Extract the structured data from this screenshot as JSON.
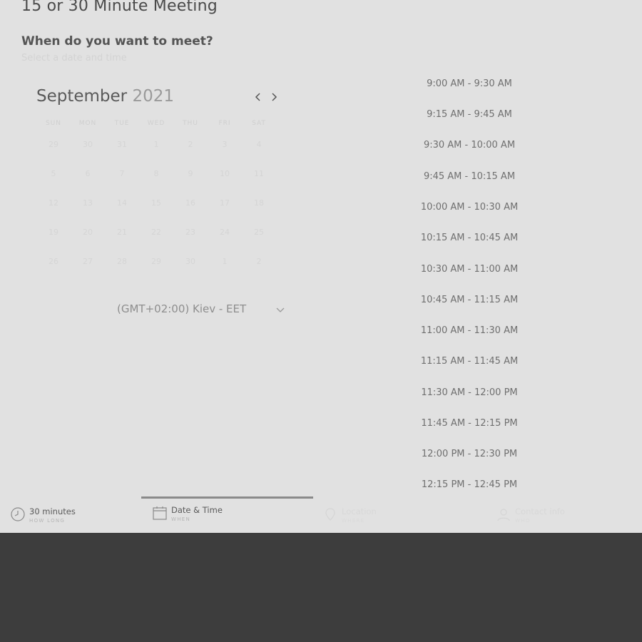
{
  "page": {
    "title": "15 or 30 Minute Meeting",
    "question": "When do you want to meet?",
    "subtitle": "Select a date and time"
  },
  "calendar": {
    "month": "September",
    "year": "2021",
    "prev_icon": "chevron-left-icon",
    "next_icon": "chevron-right-icon",
    "weekdays": [
      "SUN",
      "MON",
      "TUE",
      "WED",
      "THU",
      "FRI",
      "SAT"
    ],
    "weeks": [
      [
        "29",
        "30",
        "31",
        "1",
        "2",
        "3",
        "4"
      ],
      [
        "5",
        "6",
        "7",
        "8",
        "9",
        "10",
        "11"
      ],
      [
        "12",
        "13",
        "14",
        "15",
        "16",
        "17",
        "18"
      ],
      [
        "19",
        "20",
        "21",
        "22",
        "23",
        "24",
        "25"
      ],
      [
        "26",
        "27",
        "28",
        "29",
        "30",
        "1",
        "2"
      ]
    ]
  },
  "timezone": {
    "label": "(GMT+02:00) Kiev - EET",
    "icon": "chevron-down-icon"
  },
  "slots": [
    "9:00 AM - 9:30 AM",
    "9:15 AM - 9:45 AM",
    "9:30 AM - 10:00 AM",
    "9:45 AM - 10:15 AM",
    "10:00 AM - 10:30 AM",
    "10:15 AM - 10:45 AM",
    "10:30 AM - 11:00 AM",
    "10:45 AM - 11:15 AM",
    "11:00 AM - 11:30 AM",
    "11:15 AM - 11:45 AM",
    "11:30 AM - 12:00 PM",
    "11:45 AM - 12:15 PM",
    "12:00 PM - 12:30 PM",
    "12:15 PM - 12:45 PM"
  ],
  "tabs": [
    {
      "label": "30 minutes",
      "sub": "HOW LONG",
      "icon": "clock-icon"
    },
    {
      "label": "Date & Time",
      "sub": "WHEN",
      "icon": "calendar-icon"
    },
    {
      "label": "Location",
      "sub": "WHERE",
      "icon": "location-icon"
    },
    {
      "label": "Contact info",
      "sub": "WHO",
      "icon": "person-icon"
    }
  ],
  "colors": {
    "panel_bg": "#e1e1e1",
    "page_bg": "#3d3d3d",
    "active_tab_indicator": "#8a8a8a"
  }
}
